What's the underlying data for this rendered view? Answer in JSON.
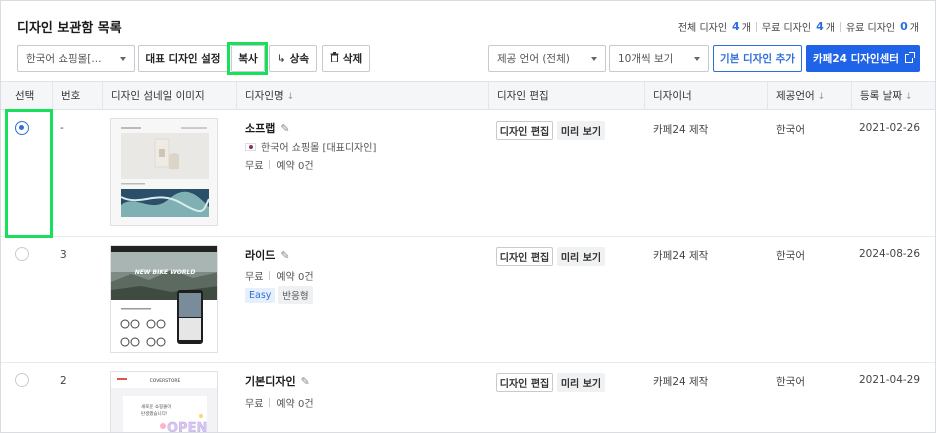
{
  "header": {
    "title": "디자인 보관함 목록",
    "counts": [
      {
        "label": "전체 디자인",
        "value": "4",
        "unit": "개"
      },
      {
        "label": "무료 디자인",
        "value": "4",
        "unit": "개"
      },
      {
        "label": "유료 디자인",
        "value": "0",
        "unit": "개"
      }
    ]
  },
  "toolbar": {
    "shop_select": "한국어 쇼핑몰[...",
    "set_default": "대표 디자인 설정",
    "copy": "복사",
    "inherit": "상속",
    "delete": "삭제",
    "language_select": "제공 언어 (전체)",
    "page_size_select": "10개씩 보기",
    "add_basic": "기본 디자인 추가",
    "design_center": "카페24 디자인센터"
  },
  "columns": {
    "select": "선택",
    "number": "번호",
    "thumbnail": "디자인 섬네일 이미지",
    "name": "디자인명",
    "edit": "디자인 편집",
    "designer": "디자이너",
    "language": "제공언어",
    "date": "등록 날짜"
  },
  "row_buttons": {
    "edit": "디자인 편집",
    "preview": "미리 보기"
  },
  "rows": [
    {
      "selected": true,
      "number": "-",
      "name": "소프랩",
      "shop_info": "한국어 쇼핑몰 [대표디자인]",
      "price": "무료",
      "reservation": "예약 0건",
      "tags": [],
      "designer": "카페24 제작",
      "language": "한국어",
      "date": "2021-02-26"
    },
    {
      "selected": false,
      "number": "3",
      "name": "라이드",
      "shop_info": "",
      "price": "무료",
      "reservation": "예약 0건",
      "tags": [
        "Easy",
        "반응형"
      ],
      "designer": "카페24 제작",
      "language": "한국어",
      "date": "2024-08-26",
      "thumb_text": "NEW BIKE WORLD"
    },
    {
      "selected": false,
      "number": "2",
      "name": "기본디자인",
      "shop_info": "",
      "price": "무료",
      "reservation": "예약 0건",
      "tags": [],
      "designer": "카페24 제작",
      "language": "한국어",
      "date": "2021-04-29",
      "thumb_brand": "COVERSTORE",
      "thumb_text_1": "새로운 쇼핑몰이",
      "thumb_text_2": "탄생했습니다!",
      "thumb_badge": "OPEN"
    }
  ],
  "colors": {
    "accent": "#2f6fdc",
    "primary_button": "#1f63e8",
    "highlight": "#19e05a"
  }
}
